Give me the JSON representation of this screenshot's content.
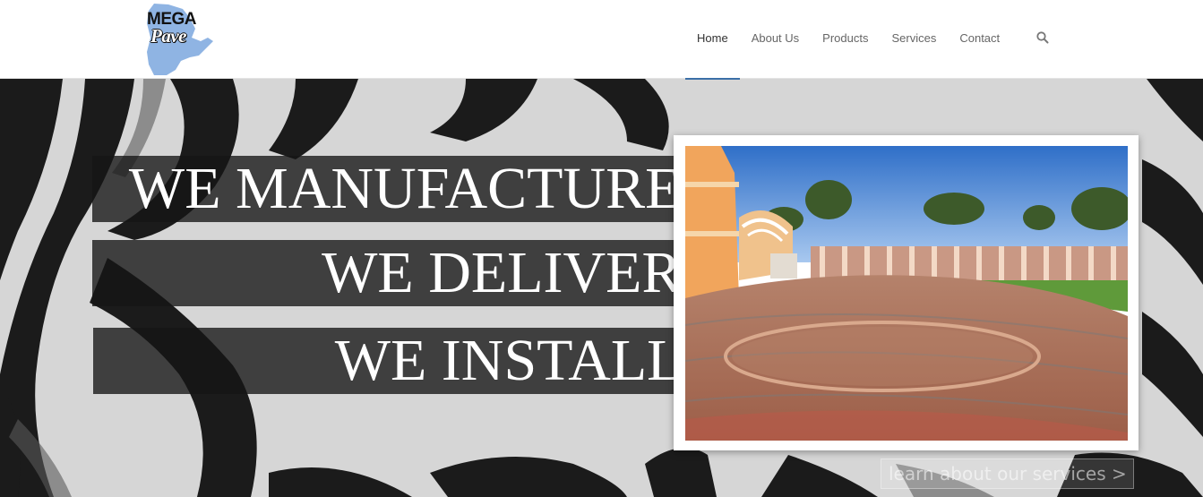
{
  "brand": {
    "logo_top": "MEGA",
    "logo_bottom": "Pave",
    "map_color": "#8fb4e3"
  },
  "nav": {
    "items": [
      {
        "label": "Home",
        "active": true
      },
      {
        "label": "About Us"
      },
      {
        "label": "Products"
      },
      {
        "label": "Services"
      },
      {
        "label": "Contact"
      }
    ],
    "search_icon": "search-icon",
    "active_color": "#3b6fa7"
  },
  "hero": {
    "lines": [
      "WE MANUFACTURE.",
      "WE DELIVER.",
      "WE INSTALL."
    ],
    "cta": "learn about our services >"
  }
}
